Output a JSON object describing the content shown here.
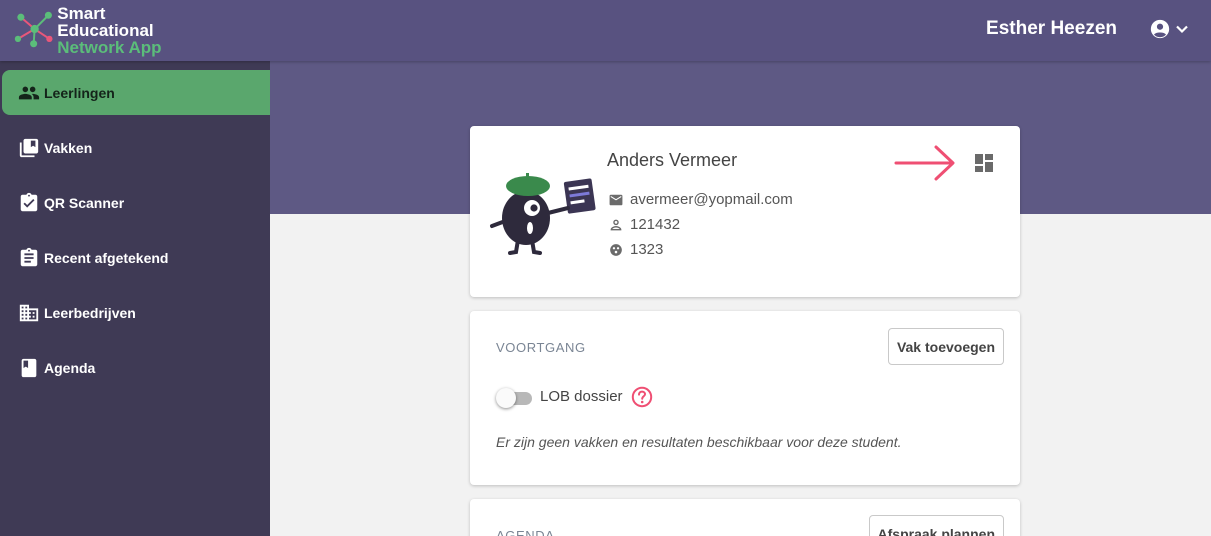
{
  "app": {
    "title_line1": "Smart Educational",
    "title_line2": "Network App"
  },
  "header": {
    "user_name": "Esther Heezen"
  },
  "sidebar": {
    "items": [
      {
        "label": "Leerlingen",
        "icon": "people-icon",
        "active": true
      },
      {
        "label": "Vakken",
        "icon": "library-books-icon",
        "active": false
      },
      {
        "label": "QR Scanner",
        "icon": "clipboard-check-icon",
        "active": false
      },
      {
        "label": "Recent afgetekend",
        "icon": "assignment-icon",
        "active": false
      },
      {
        "label": "Leerbedrijven",
        "icon": "business-icon",
        "active": false
      },
      {
        "label": "Agenda",
        "icon": "book-icon",
        "active": false
      }
    ]
  },
  "student": {
    "name": "Anders Vermeer",
    "email": "avermeer@yopmail.com",
    "number": "121432",
    "group": "1323"
  },
  "progress": {
    "title": "VOORTGANG",
    "add_subject_label": "Vak toevoegen",
    "toggle_label": "LOB dossier",
    "empty_message": "Er zijn geen vakken en resultaten beschikbaar voor deze student."
  },
  "agenda": {
    "title": "AGENDA",
    "plan_label": "Afspraak plannen"
  },
  "colors": {
    "header": "#585280",
    "band": "#5e5984",
    "sidebar": "#3f3a55",
    "active": "#5aa76d",
    "accent": "#ef4f73",
    "logo_green": "#5bbd7a"
  }
}
